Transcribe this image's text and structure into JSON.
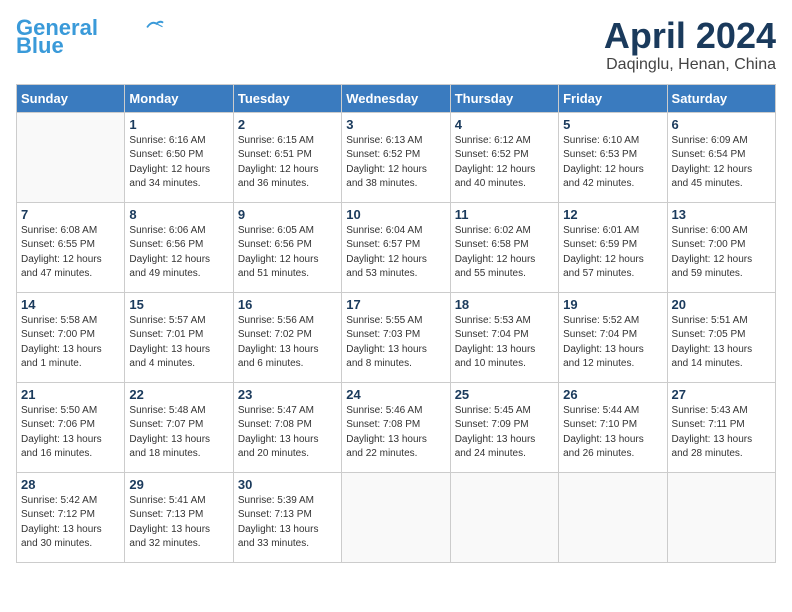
{
  "header": {
    "logo_line1": "General",
    "logo_line2": "Blue",
    "title": "April 2024",
    "subtitle": "Daqinglu, Henan, China"
  },
  "weekdays": [
    "Sunday",
    "Monday",
    "Tuesday",
    "Wednesday",
    "Thursday",
    "Friday",
    "Saturday"
  ],
  "weeks": [
    [
      {
        "day": null,
        "info": null
      },
      {
        "day": "1",
        "info": "Sunrise: 6:16 AM\nSunset: 6:50 PM\nDaylight: 12 hours\nand 34 minutes."
      },
      {
        "day": "2",
        "info": "Sunrise: 6:15 AM\nSunset: 6:51 PM\nDaylight: 12 hours\nand 36 minutes."
      },
      {
        "day": "3",
        "info": "Sunrise: 6:13 AM\nSunset: 6:52 PM\nDaylight: 12 hours\nand 38 minutes."
      },
      {
        "day": "4",
        "info": "Sunrise: 6:12 AM\nSunset: 6:52 PM\nDaylight: 12 hours\nand 40 minutes."
      },
      {
        "day": "5",
        "info": "Sunrise: 6:10 AM\nSunset: 6:53 PM\nDaylight: 12 hours\nand 42 minutes."
      },
      {
        "day": "6",
        "info": "Sunrise: 6:09 AM\nSunset: 6:54 PM\nDaylight: 12 hours\nand 45 minutes."
      }
    ],
    [
      {
        "day": "7",
        "info": "Sunrise: 6:08 AM\nSunset: 6:55 PM\nDaylight: 12 hours\nand 47 minutes."
      },
      {
        "day": "8",
        "info": "Sunrise: 6:06 AM\nSunset: 6:56 PM\nDaylight: 12 hours\nand 49 minutes."
      },
      {
        "day": "9",
        "info": "Sunrise: 6:05 AM\nSunset: 6:56 PM\nDaylight: 12 hours\nand 51 minutes."
      },
      {
        "day": "10",
        "info": "Sunrise: 6:04 AM\nSunset: 6:57 PM\nDaylight: 12 hours\nand 53 minutes."
      },
      {
        "day": "11",
        "info": "Sunrise: 6:02 AM\nSunset: 6:58 PM\nDaylight: 12 hours\nand 55 minutes."
      },
      {
        "day": "12",
        "info": "Sunrise: 6:01 AM\nSunset: 6:59 PM\nDaylight: 12 hours\nand 57 minutes."
      },
      {
        "day": "13",
        "info": "Sunrise: 6:00 AM\nSunset: 7:00 PM\nDaylight: 12 hours\nand 59 minutes."
      }
    ],
    [
      {
        "day": "14",
        "info": "Sunrise: 5:58 AM\nSunset: 7:00 PM\nDaylight: 13 hours\nand 1 minute."
      },
      {
        "day": "15",
        "info": "Sunrise: 5:57 AM\nSunset: 7:01 PM\nDaylight: 13 hours\nand 4 minutes."
      },
      {
        "day": "16",
        "info": "Sunrise: 5:56 AM\nSunset: 7:02 PM\nDaylight: 13 hours\nand 6 minutes."
      },
      {
        "day": "17",
        "info": "Sunrise: 5:55 AM\nSunset: 7:03 PM\nDaylight: 13 hours\nand 8 minutes."
      },
      {
        "day": "18",
        "info": "Sunrise: 5:53 AM\nSunset: 7:04 PM\nDaylight: 13 hours\nand 10 minutes."
      },
      {
        "day": "19",
        "info": "Sunrise: 5:52 AM\nSunset: 7:04 PM\nDaylight: 13 hours\nand 12 minutes."
      },
      {
        "day": "20",
        "info": "Sunrise: 5:51 AM\nSunset: 7:05 PM\nDaylight: 13 hours\nand 14 minutes."
      }
    ],
    [
      {
        "day": "21",
        "info": "Sunrise: 5:50 AM\nSunset: 7:06 PM\nDaylight: 13 hours\nand 16 minutes."
      },
      {
        "day": "22",
        "info": "Sunrise: 5:48 AM\nSunset: 7:07 PM\nDaylight: 13 hours\nand 18 minutes."
      },
      {
        "day": "23",
        "info": "Sunrise: 5:47 AM\nSunset: 7:08 PM\nDaylight: 13 hours\nand 20 minutes."
      },
      {
        "day": "24",
        "info": "Sunrise: 5:46 AM\nSunset: 7:08 PM\nDaylight: 13 hours\nand 22 minutes."
      },
      {
        "day": "25",
        "info": "Sunrise: 5:45 AM\nSunset: 7:09 PM\nDaylight: 13 hours\nand 24 minutes."
      },
      {
        "day": "26",
        "info": "Sunrise: 5:44 AM\nSunset: 7:10 PM\nDaylight: 13 hours\nand 26 minutes."
      },
      {
        "day": "27",
        "info": "Sunrise: 5:43 AM\nSunset: 7:11 PM\nDaylight: 13 hours\nand 28 minutes."
      }
    ],
    [
      {
        "day": "28",
        "info": "Sunrise: 5:42 AM\nSunset: 7:12 PM\nDaylight: 13 hours\nand 30 minutes."
      },
      {
        "day": "29",
        "info": "Sunrise: 5:41 AM\nSunset: 7:13 PM\nDaylight: 13 hours\nand 32 minutes."
      },
      {
        "day": "30",
        "info": "Sunrise: 5:39 AM\nSunset: 7:13 PM\nDaylight: 13 hours\nand 33 minutes."
      },
      {
        "day": null,
        "info": null
      },
      {
        "day": null,
        "info": null
      },
      {
        "day": null,
        "info": null
      },
      {
        "day": null,
        "info": null
      }
    ]
  ]
}
